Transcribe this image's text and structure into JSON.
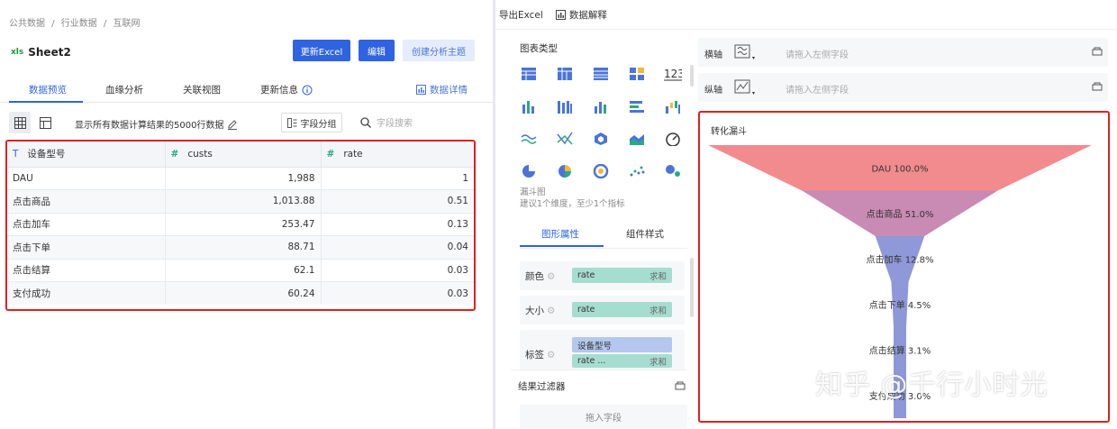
{
  "breadcrumb": [
    "公共数据",
    "/",
    "行业数据",
    "/",
    "互联网"
  ],
  "sheet": {
    "icon": "xls",
    "name": "Sheet2"
  },
  "buttons": {
    "update_excel": "更新Excel",
    "edit": "编辑",
    "create_topic": "创建分析主题"
  },
  "tabs": [
    {
      "label": "数据预览",
      "active": true
    },
    {
      "label": "血缘分析",
      "active": false
    },
    {
      "label": "关联视图",
      "active": false
    },
    {
      "label": "更新信息",
      "active": false
    }
  ],
  "detail_link": "数据详情",
  "toolbar": {
    "info": "显示所有数据计算结果的5000行数据",
    "group": "字段分组",
    "search_placeholder": "字段搜索"
  },
  "table": {
    "columns": [
      {
        "name": "设备型号",
        "type": "text"
      },
      {
        "name": "custs",
        "type": "number"
      },
      {
        "name": "rate",
        "type": "number"
      }
    ],
    "rows": [
      [
        "DAU",
        "1,988",
        "1"
      ],
      [
        "点击商品",
        "1,013.88",
        "0.51"
      ],
      [
        "点击加车",
        "253.47",
        "0.13"
      ],
      [
        "点击下单",
        "88.71",
        "0.04"
      ],
      [
        "点击结算",
        "62.1",
        "0.03"
      ],
      [
        "支付成功",
        "60.24",
        "0.03"
      ]
    ]
  },
  "right_top": {
    "export": "导出Excel",
    "explain": "数据解释"
  },
  "chart_types": {
    "title": "图表类型",
    "note_title": "漏斗图",
    "note_text": "建议1个维度，至少1个指标"
  },
  "sub_tabs": {
    "graphic": "图形属性",
    "component": "组件样式"
  },
  "props": {
    "color": {
      "label": "颜色",
      "field": "rate",
      "agg": "求和"
    },
    "size": {
      "label": "大小",
      "field": "rate",
      "agg": "求和"
    },
    "tag": {
      "label": "标签",
      "field1": "设备型号",
      "field2": "rate ...",
      "agg2": "求和"
    }
  },
  "filter": {
    "title": "结果过滤器",
    "drop": "拖入字段"
  },
  "axes": {
    "x": {
      "label": "横轴",
      "placeholder": "请拖入左侧字段"
    },
    "y": {
      "label": "纵轴",
      "placeholder": "请拖入左侧字段"
    }
  },
  "chart_title": "转化漏斗",
  "watermark": "知乎 @千行小时光",
  "colors": {
    "primary": "#2f63e0",
    "highlight": "#e02020",
    "funnel1": "#f28b8e",
    "funnel2": "#c98ab4",
    "funnel3": "#8f98d9",
    "funnel_rest": "#8e98d8"
  },
  "chart_data": {
    "type": "funnel",
    "categories": [
      "DAU",
      "点击商品",
      "点击加车",
      "点击下单",
      "点击结算",
      "支付成功"
    ],
    "values": [
      100.0,
      51.0,
      12.8,
      4.5,
      3.1,
      3.0
    ],
    "labels": [
      "100.0%",
      "51.0%",
      "12.8%",
      "4.5%",
      "3.1%",
      "3.0%"
    ]
  }
}
